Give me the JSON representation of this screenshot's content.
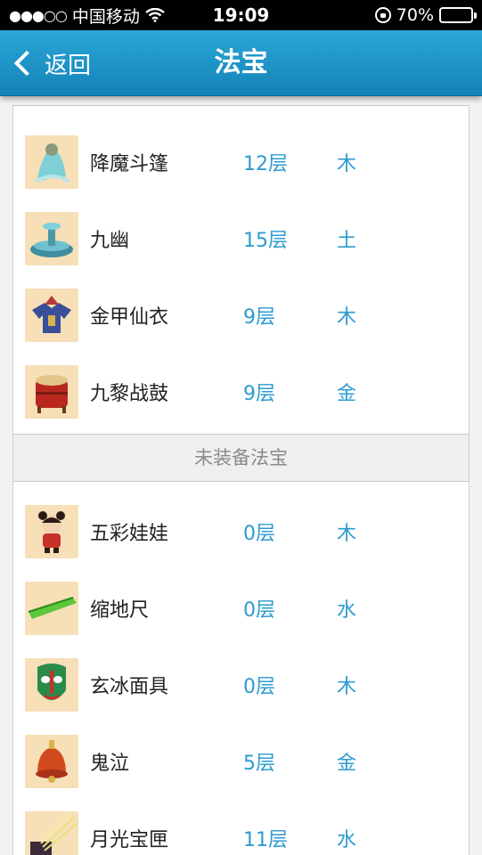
{
  "status_bar": {
    "signal": "●●●○○",
    "carrier": "中国移动",
    "time": "19:09",
    "battery_percent": "70%",
    "battery_level": 0.7
  },
  "nav": {
    "back_label": "返回",
    "title": "法宝"
  },
  "equipped": [
    {
      "name": "降魔斗篷",
      "level": "12层",
      "element": "木",
      "icon": "cloak-icon"
    },
    {
      "name": "九幽",
      "level": "15层",
      "element": "土",
      "icon": "fountain-icon"
    },
    {
      "name": "金甲仙衣",
      "level": "9层",
      "element": "木",
      "icon": "armor-icon"
    },
    {
      "name": "九黎战鼓",
      "level": "9层",
      "element": "金",
      "icon": "drum-icon"
    }
  ],
  "unequipped_header": "未装备法宝",
  "unequipped": [
    {
      "name": "五彩娃娃",
      "level": "0层",
      "element": "木",
      "icon": "doll-icon"
    },
    {
      "name": "缩地尺",
      "level": "0层",
      "element": "水",
      "icon": "ruler-icon"
    },
    {
      "name": "玄冰面具",
      "level": "0层",
      "element": "木",
      "icon": "mask-icon"
    },
    {
      "name": "鬼泣",
      "level": "5层",
      "element": "金",
      "icon": "bell-icon"
    },
    {
      "name": "月光宝匣",
      "level": "11层",
      "element": "水",
      "icon": "box-icon"
    }
  ],
  "colors": {
    "nav_blue": "#1e96cc",
    "accent_text": "#2d9bcf",
    "thumb_bg": "#f7dfb7"
  }
}
